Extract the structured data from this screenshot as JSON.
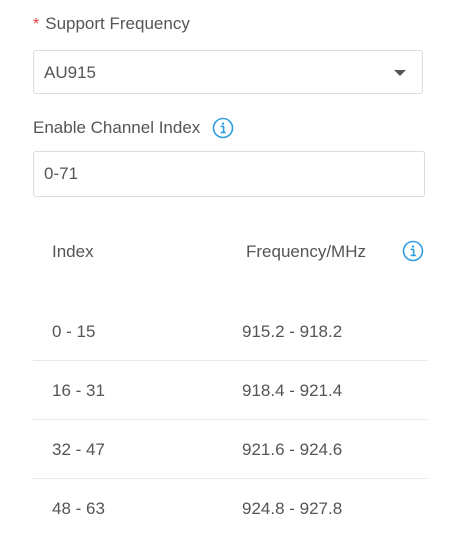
{
  "support_frequency": {
    "required_mark": "*",
    "label": "Support Frequency",
    "selected_value": "AU915"
  },
  "channel_index": {
    "label": "Enable Channel Index",
    "value": "0-71"
  },
  "table": {
    "headers": {
      "index": "Index",
      "frequency": "Frequency/MHz"
    },
    "rows": [
      {
        "index": "0 - 15",
        "frequency": "915.2 - 918.2"
      },
      {
        "index": "16 - 31",
        "frequency": "918.4 - 921.4"
      },
      {
        "index": "32 - 47",
        "frequency": "921.6 - 924.6"
      },
      {
        "index": "48 - 63",
        "frequency": "924.8 - 927.8"
      }
    ]
  },
  "colors": {
    "accent": "#2f9de0",
    "required": "#e23b3b",
    "text": "#555555",
    "border": "#dcdcdc"
  },
  "icons": {
    "info": "info-circle-icon",
    "caret": "caret-down-icon"
  }
}
